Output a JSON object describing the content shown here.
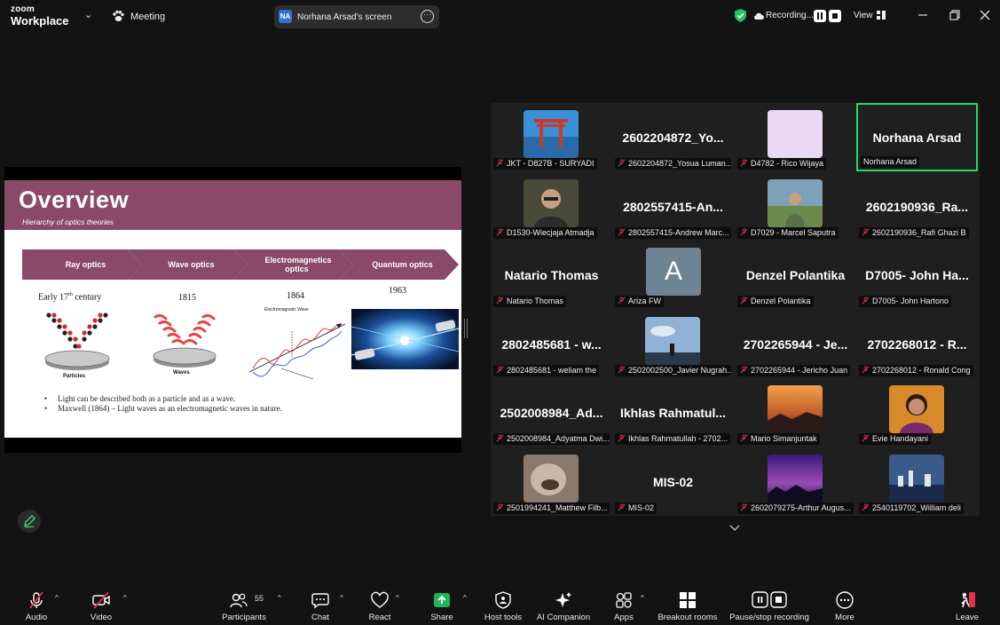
{
  "titlebar": {
    "brand_line1": "zoom",
    "brand_line2": "Workplace",
    "meeting_label": "Meeting",
    "share_badge": "NA",
    "share_label": "Norhana Arsad's screen",
    "recording_label": "Recording...",
    "view_label": "View"
  },
  "slide": {
    "title": "Overview",
    "subtitle": "Hierarchy of optics theories",
    "arrows": [
      "Ray optics",
      "Wave optics",
      "Electromagnetics optics",
      "Quantum optics"
    ],
    "eras": [
      "Early 17th century",
      "1815",
      "1864",
      "1963"
    ],
    "caption_particles": "Particles",
    "caption_waves": "Waves",
    "caption_em": "Electromagnetic Wave",
    "bullets": [
      "Light can be described both as a particle and as a wave.",
      "Maxwell (1864) – Light waves as an electromagnetic waves in nature."
    ]
  },
  "gallery": {
    "tiles": [
      {
        "name": "",
        "label": "JKT - D827B - SURYADI",
        "photo": "torii"
      },
      {
        "name": "2602204872_Yo...",
        "label": "2602204872_Yosua Luman...",
        "photo": ""
      },
      {
        "name": "",
        "label": "D4782 - Rico Wijaya",
        "photo": "lavender"
      },
      {
        "name": "Norhana Arsad",
        "label": "Norhana Arsad",
        "photo": "",
        "active": true
      },
      {
        "name": "",
        "label": "D1530-Wiecjaja Atmadja",
        "photo": "man"
      },
      {
        "name": "2802557415-An...",
        "label": "2802557415-Andrew Marc...",
        "photo": ""
      },
      {
        "name": "",
        "label": "D7029 - Marcel Saputra",
        "photo": "outdoor"
      },
      {
        "name": "2602190936_Ra...",
        "label": "2602190936_Rafi Ghazi B",
        "photo": ""
      },
      {
        "name": "Natario Thomas",
        "label": "Natario Thomas",
        "photo": ""
      },
      {
        "name": "",
        "label": "Ariza FW",
        "photo": "avatar",
        "initial": "A"
      },
      {
        "name": "Denzel Polantika",
        "label": "Denzel Polantika",
        "photo": ""
      },
      {
        "name": "D7005- John Ha...",
        "label": "D7005- John Hartono",
        "photo": ""
      },
      {
        "name": "2802485681 - w...",
        "label": "2802485681 - weliam the",
        "photo": ""
      },
      {
        "name": "",
        "label": "2502002500_Javier Nugrah...",
        "photo": "sky"
      },
      {
        "name": "2702265944 - Je...",
        "label": "2702265944 - Jericho Juan",
        "photo": ""
      },
      {
        "name": "2702268012 - R...",
        "label": "2702268012 - Ronald Cong",
        "photo": ""
      },
      {
        "name": "2502008984_Ad...",
        "label": "2502008984_Adyatma Dwi...",
        "photo": ""
      },
      {
        "name": "Ikhlas Rahmatul...",
        "label": "Ikhlas Rahmatullah - 2702...",
        "photo": ""
      },
      {
        "name": "",
        "label": "Mario Simanjuntak",
        "photo": "sunset"
      },
      {
        "name": "",
        "label": "Evie Handayani",
        "photo": "woman"
      },
      {
        "name": "",
        "label": "2501994241_Matthew Filb...",
        "photo": "blur"
      },
      {
        "name": "MIS-02",
        "label": "MIS-02",
        "photo": ""
      },
      {
        "name": "",
        "label": "2602079275-Arthur Augus...",
        "photo": "galaxy"
      },
      {
        "name": "",
        "label": "2540119702_William deli",
        "photo": "city"
      }
    ]
  },
  "toolbar": {
    "audio": "Audio",
    "video": "Video",
    "participants": "Participants",
    "participants_count": "55",
    "chat": "Chat",
    "react": "React",
    "share": "Share",
    "host_tools": "Host tools",
    "ai_companion": "AI Companion",
    "apps": "Apps",
    "breakout_rooms": "Breakout rooms",
    "pause_stop_recording": "Pause/stop recording",
    "more": "More",
    "leave": "Leave"
  },
  "colors": {
    "slide_accent": "#8a4a67",
    "active_speaker": "#23d96b",
    "share_green": "#1fb45a",
    "leave_red": "#e0304a"
  }
}
